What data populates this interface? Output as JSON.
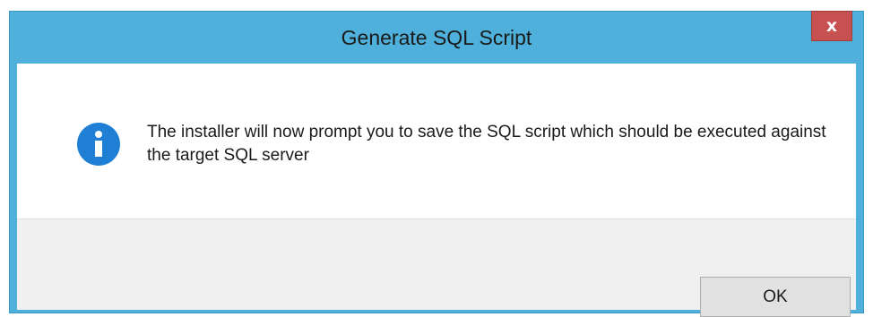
{
  "dialog": {
    "title": "Generate SQL Script",
    "close_label": "x",
    "icon": "info-icon",
    "message": "The installer will now prompt you to save the SQL script which should be executed against the target SQL server",
    "ok_label": "OK"
  },
  "colors": {
    "titlebar": "#4fb1db",
    "close_button": "#c75050",
    "info_icon": "#1e7fd4",
    "footer": "#f0f0f0",
    "button": "#e1e1e1"
  }
}
